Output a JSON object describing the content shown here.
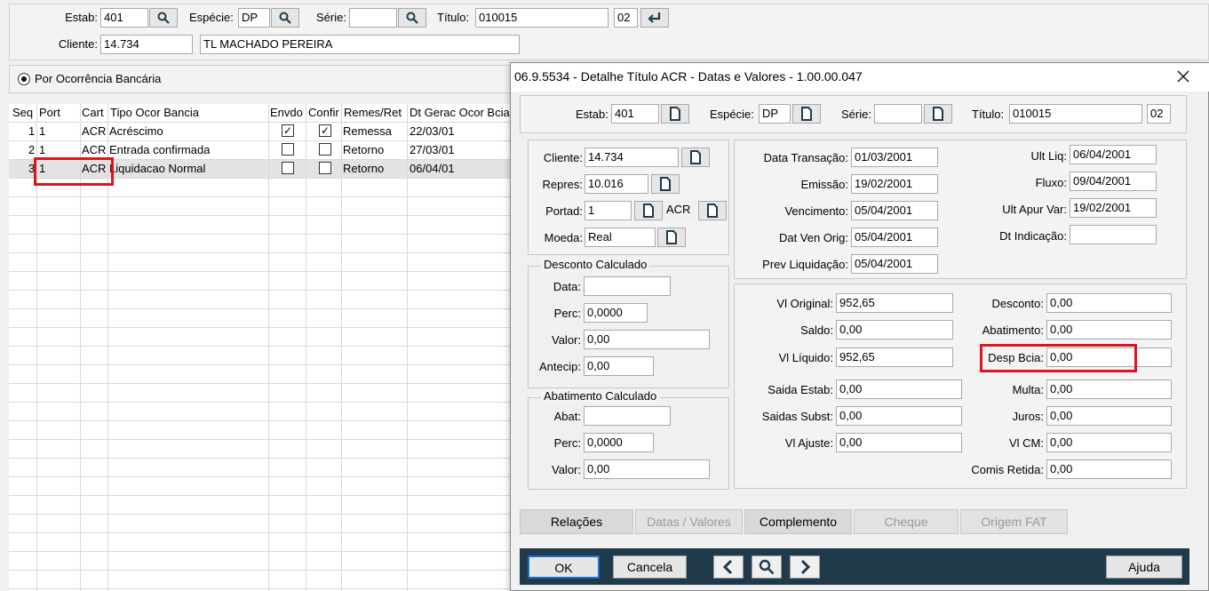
{
  "main": {
    "estab_label": "Estab:",
    "estab": "401",
    "especie_label": "Espécie:",
    "especie": "DP",
    "serie_label": "Série:",
    "serie": "",
    "titulo_label": "Título:",
    "titulo": "010015",
    "parcela": "02",
    "cliente_label": "Cliente:",
    "cliente_code": "14.734",
    "cliente_name": "TL MACHADO PEREIRA",
    "radio_label": "Por Ocorrência Bancária"
  },
  "grid": {
    "columns": [
      "Seq",
      "Port",
      "Cart",
      "Tipo Ocor Bancia",
      "Envdo",
      "Confir",
      "Remes/Ret",
      "Dt Gerac Ocor Bcia"
    ],
    "rows": [
      {
        "seq": "1",
        "port": "1",
        "cart": "ACR",
        "tipo": "Acréscimo",
        "envdo": true,
        "confir": true,
        "remes": "Remessa",
        "dt": "22/03/01"
      },
      {
        "seq": "2",
        "port": "1",
        "cart": "ACR",
        "tipo": "Entrada confirmada",
        "envdo": false,
        "confir": false,
        "remes": "Retorno",
        "dt": "27/03/01"
      },
      {
        "seq": "3",
        "port": "1",
        "cart": "ACR",
        "tipo": "Liquidacao Normal",
        "envdo": false,
        "confir": false,
        "remes": "Retorno",
        "dt": "06/04/01"
      }
    ]
  },
  "dialog": {
    "title": "06.9.5534 - Detalhe Título ACR - Datas e Valores - 1.00.00.047",
    "estab_label": "Estab:",
    "estab": "401",
    "especie_label": "Espécie:",
    "especie": "DP",
    "serie_label": "Série:",
    "serie": "",
    "titulo_label": "Título:",
    "titulo": "010015",
    "parcela": "02",
    "cliente_label": "Cliente:",
    "cliente": "14.734",
    "repres_label": "Repres:",
    "repres": "10.016",
    "portad_label": "Portad:",
    "portad": "1",
    "cart": "ACR",
    "moeda_label": "Moeda:",
    "moeda": "Real",
    "desconto_group": "Desconto Calculado",
    "desc_data_label": "Data:",
    "desc_data": "",
    "desc_perc_label": "Perc:",
    "desc_perc": "0,0000",
    "desc_valor_label": "Valor:",
    "desc_valor": "0,00",
    "antecip_label": "Antecip:",
    "antecip": "0,00",
    "abat_group": "Abatimento Calculado",
    "abat_label": "Abat:",
    "abat": "",
    "abat_perc_label": "Perc:",
    "abat_perc": "0,0000",
    "abat_valor_label": "Valor:",
    "abat_valor": "0,00",
    "data_transacao_label": "Data Transação:",
    "data_transacao": "01/03/2001",
    "emissao_label": "Emissão:",
    "emissao": "19/02/2001",
    "vencimento_label": "Vencimento:",
    "vencimento": "05/04/2001",
    "dat_ven_orig_label": "Dat Ven Orig:",
    "dat_ven_orig": "05/04/2001",
    "prev_liq_label": "Prev Liquidação:",
    "prev_liq": "05/04/2001",
    "ult_liq_label": "Ult Liq:",
    "ult_liq": "06/04/2001",
    "fluxo_label": "Fluxo:",
    "fluxo": "09/04/2001",
    "ult_apur_label": "Ult Apur Var:",
    "ult_apur": "19/02/2001",
    "dt_indicacao_label": "Dt Indicação:",
    "dt_indicacao": "",
    "vl_original_label": "Vl Original:",
    "vl_original": "952,65",
    "saldo_label": "Saldo:",
    "saldo": "0,00",
    "vl_liquido_label": "Vl Líquido:",
    "vl_liquido": "952,65",
    "saida_estab_label": "Saida Estab:",
    "saida_estab": "0,00",
    "saidas_subst_label": "Saidas Subst:",
    "saidas_subst": "0,00",
    "vl_ajuste_label": "Vl Ajuste:",
    "vl_ajuste": "0,00",
    "desconto_label": "Desconto:",
    "desconto": "0,00",
    "abatimento_label": "Abatimento:",
    "abatimento": "0,00",
    "desp_bcia_label": "Desp Bcia:",
    "desp_bcia": "0,00",
    "multa_label": "Multa:",
    "multa": "0,00",
    "juros_label": "Juros:",
    "juros": "0,00",
    "vl_cm_label": "Vl CM:",
    "vl_cm": "0,00",
    "comis_label": "Comis Retida:",
    "comis": "0,00",
    "tabs": [
      "Relações",
      "Datas / Valores",
      "Complemento",
      "Cheque",
      "Origem FAT"
    ],
    "ok": "OK",
    "cancela": "Cancela",
    "ajuda": "Ajuda"
  },
  "colors": {
    "highlight": "#e0141e",
    "bottom_bar": "#1f3a4a"
  }
}
